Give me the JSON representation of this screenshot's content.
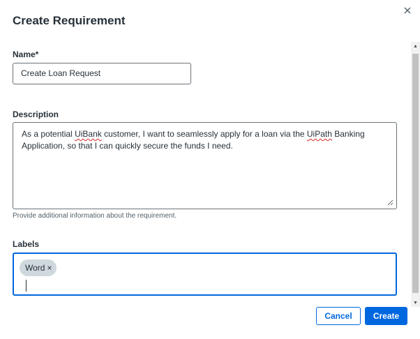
{
  "dialog": {
    "title": "Create Requirement",
    "close_icon": "close-icon"
  },
  "name_field": {
    "label": "Name*",
    "value": "Create Loan Request"
  },
  "description_field": {
    "label": "Description",
    "text_part1": "As a potential ",
    "misspelled1": "UiBank",
    "text_part2": " customer, I want to seamlessly apply for a loan via the ",
    "misspelled2": "UiPath",
    "text_part3": " Banking Application, so that I can quickly secure the funds I need.",
    "helper": "Provide additional information about the requirement."
  },
  "labels_field": {
    "label": "Labels",
    "chips": [
      {
        "text": "Word",
        "remove_icon": "×"
      }
    ]
  },
  "actions": {
    "cancel_label": "Cancel",
    "create_label": "Create"
  },
  "colors": {
    "primary": "#0067df",
    "text": "#273139",
    "chip_bg": "#cfd8dd",
    "spellcheck": "#d62b2b"
  }
}
